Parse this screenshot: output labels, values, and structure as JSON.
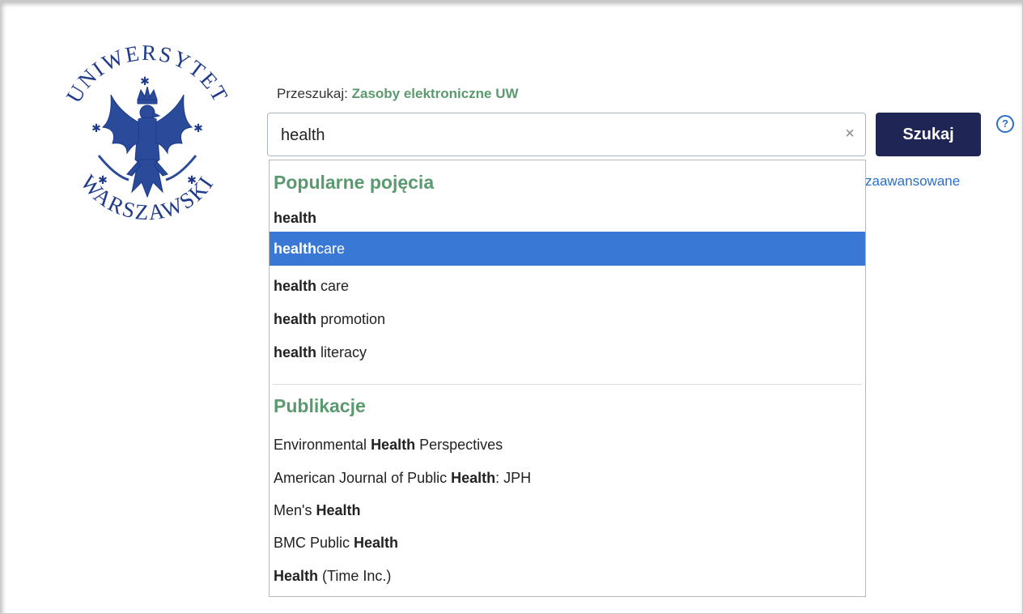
{
  "logo": {
    "top_text": "UNIWERSYTET",
    "bottom_text": "WARSZAWSKI",
    "color": "#1f3a8a"
  },
  "search": {
    "label": "Przeszukaj:",
    "scope": "Zasoby elektroniczne UW",
    "query": "health",
    "clear_icon": "×",
    "submit_label": "Szukaj",
    "help_icon": "?",
    "advanced_link_text": "zaawansowane"
  },
  "dropdown": {
    "popular": {
      "heading": "Popularne pojęcia",
      "items": [
        {
          "bold": "health",
          "rest": "",
          "active": false
        },
        {
          "bold": "health",
          "rest": "care",
          "active": true
        },
        {
          "bold": "health",
          "rest": " care",
          "active": false
        },
        {
          "bold": "health",
          "rest": " promotion",
          "active": false
        },
        {
          "bold": "health",
          "rest": " literacy",
          "active": false
        }
      ]
    },
    "publications": {
      "heading": "Publikacje",
      "items": [
        {
          "before": "Environmental ",
          "bold": "Health",
          "after": " Perspectives"
        },
        {
          "before": "American Journal of Public ",
          "bold": "Health",
          "after": ": JPH"
        },
        {
          "before": "Men's ",
          "bold": "Health",
          "after": ""
        },
        {
          "before": "BMC Public ",
          "bold": "Health",
          "after": ""
        },
        {
          "before": "",
          "bold": "Health",
          "after": " (Time Inc.)"
        }
      ]
    }
  },
  "colors": {
    "accent_green": "#5a9a6f",
    "submit_bg": "#1f2554",
    "active_row": "#3a78d6",
    "link_blue": "#2b6fc9"
  }
}
